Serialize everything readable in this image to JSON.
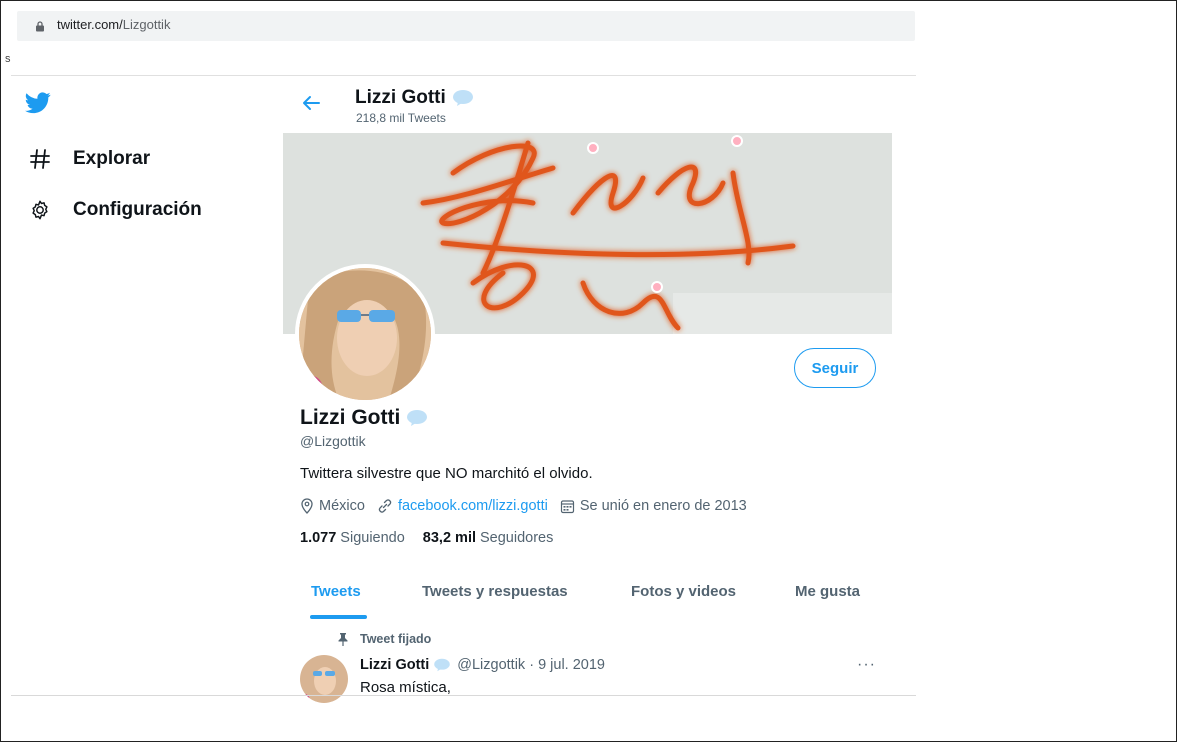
{
  "browser": {
    "url_host": "twitter.com/",
    "url_path": "Lizgottik",
    "edge_char": "s"
  },
  "nav": {
    "items": [
      {
        "label": "Explorar",
        "icon": "hashtag-icon"
      },
      {
        "label": "Configuración",
        "icon": "gear-icon"
      }
    ]
  },
  "header": {
    "name": "Lizzi Gotti",
    "tweet_count": "218,8 mil Tweets"
  },
  "profile": {
    "name": "Lizzi Gotti",
    "handle": "@Lizgottik",
    "bio": "Twittera silvestre que NO marchitó el olvido.",
    "location": "México",
    "link": "facebook.com/lizzi.gotti",
    "joined": "Se unió en enero de 2013",
    "following_count": "1.077",
    "following_label": "Siguiendo",
    "followers_count": "83,2 mil",
    "followers_label": "Seguidores",
    "follow_button": "Seguir"
  },
  "tabs": [
    {
      "label": "Tweets",
      "active": true
    },
    {
      "label": "Tweets y respuestas",
      "active": false
    },
    {
      "label": "Fotos y videos",
      "active": false
    },
    {
      "label": "Me gusta",
      "active": false
    }
  ],
  "pinned_tweet": {
    "pin_label": "Tweet fijado",
    "name": "Lizzi Gotti",
    "handle_date": "@Lizgottik · 9 jul. 2019",
    "text": "Rosa mística,",
    "more": "···"
  },
  "colors": {
    "accent": "#1d9bf0",
    "text": "#0f1419",
    "secondary": "#536471"
  }
}
